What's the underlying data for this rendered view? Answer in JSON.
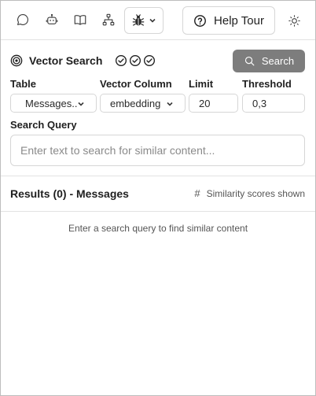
{
  "toolbar": {
    "icons": [
      "chat-icon",
      "robot-icon",
      "book-icon",
      "sitemap-icon"
    ],
    "bug_menu_icon": "bug-icon",
    "help_label": "Help Tour",
    "theme_icon": "sun-icon"
  },
  "vector_search": {
    "title": "Vector Search",
    "status_icons": [
      "check-circle-icon",
      "check-circle-icon",
      "check-circle-icon"
    ],
    "search_button_label": "Search"
  },
  "form": {
    "table_label": "Table",
    "table_value": "Messages..",
    "vector_column_label": "Vector Column",
    "vector_column_value": "embedding",
    "limit_label": "Limit",
    "limit_value": "20",
    "threshold_label": "Threshold",
    "threshold_value": "0,3",
    "query_label": "Search Query",
    "query_placeholder": "Enter text to search for similar content..."
  },
  "results": {
    "title": "Results (0) - Messages",
    "similarity_hint": "Similarity scores shown",
    "empty_message": "Enter a search query to find similar content"
  },
  "colors": {
    "search_button_bg": "#7d7d7d",
    "border": "#d6d6d6",
    "divider": "#e2e2e2"
  }
}
